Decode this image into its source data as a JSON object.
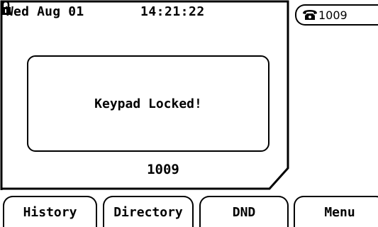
{
  "status_bar": {
    "date": "Wed Aug 01",
    "time": "14:21:22",
    "lock_icon": "padlock-icon"
  },
  "popup": {
    "message": "Keypad Locked!"
  },
  "main": {
    "extension": "1009"
  },
  "line_key": {
    "icon": "phone-icon",
    "label": "1009"
  },
  "softkeys": [
    {
      "label": "History"
    },
    {
      "label": "Directory"
    },
    {
      "label": "DND"
    },
    {
      "label": "Menu"
    }
  ]
}
